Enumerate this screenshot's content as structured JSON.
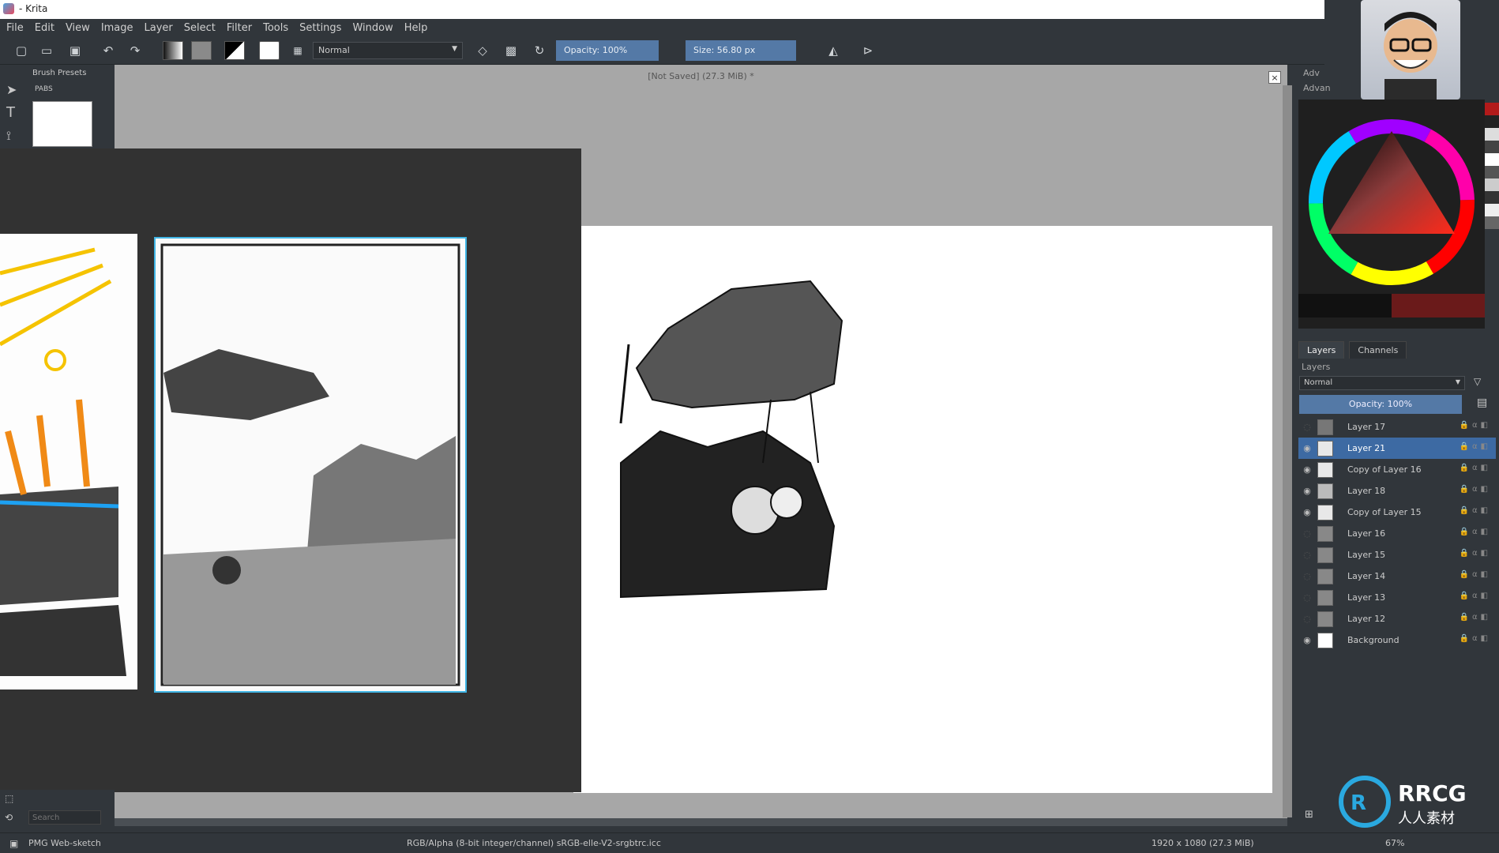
{
  "window": {
    "title": "- Krita",
    "app_title": "- Krita"
  },
  "menu": [
    "File",
    "Edit",
    "View",
    "Image",
    "Layer",
    "Select",
    "Filter",
    "Tools",
    "Settings",
    "Window",
    "Help"
  ],
  "toolbar": {
    "blend_mode": "Normal",
    "opacity_label": "Opacity:  100%",
    "size_label": "Size:  56.80 px"
  },
  "brush_presets": {
    "title": "Brush Presets",
    "tag": "PABS"
  },
  "document": {
    "title": "[Not Saved]  (27.3 MiB) *"
  },
  "right_dock": {
    "adv_tab_1": "Adv",
    "adv_tab_2": "Advan"
  },
  "layers_panel": {
    "tabs": [
      "Layers",
      "Channels"
    ],
    "title": "Layers",
    "blend_mode": "Normal",
    "opacity_label": "Opacity:  100%",
    "layers": [
      {
        "name": "Layer 17",
        "visible": false,
        "active": false
      },
      {
        "name": "Layer 21",
        "visible": true,
        "active": true
      },
      {
        "name": "Copy of Layer 16",
        "visible": true,
        "active": false
      },
      {
        "name": "Layer 18",
        "visible": true,
        "active": false
      },
      {
        "name": "Copy of Layer 15",
        "visible": true,
        "active": false
      },
      {
        "name": "Layer 16",
        "visible": false,
        "active": false
      },
      {
        "name": "Layer 15",
        "visible": false,
        "active": false
      },
      {
        "name": "Layer 14",
        "visible": false,
        "active": false
      },
      {
        "name": "Layer 13",
        "visible": false,
        "active": false
      },
      {
        "name": "Layer 12",
        "visible": false,
        "active": false
      },
      {
        "name": "Background",
        "visible": true,
        "active": false
      }
    ]
  },
  "search": {
    "placeholder": "Search"
  },
  "statusbar": {
    "brush_name": "PMG Web-sketch",
    "color_info": "RGB/Alpha (8-bit integer/channel)  sRGB-elle-V2-srgbtrc.icc",
    "image_size": "1920 x 1080 (27.3 MiB)",
    "zoom": "67%"
  },
  "watermark": {
    "text_1": "RRCG",
    "text_2": "人人素材"
  },
  "colors": {
    "accent": "#5479a6",
    "active_layer": "#3d6aa3",
    "bg": "#31363b"
  }
}
